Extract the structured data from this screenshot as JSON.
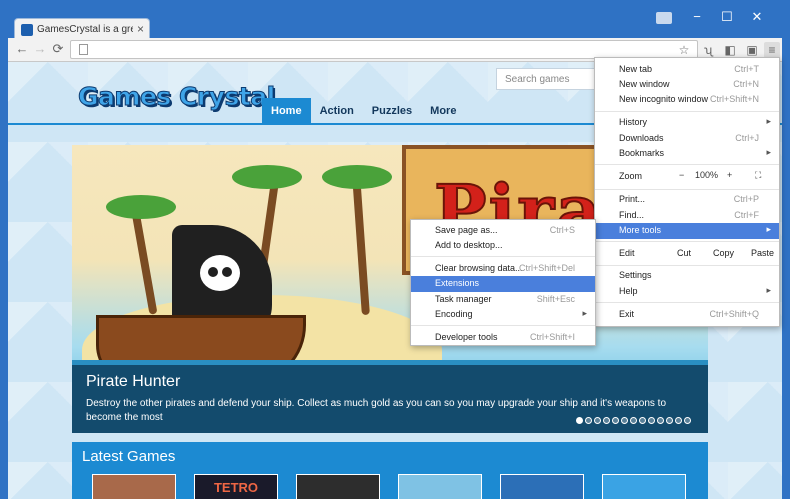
{
  "browser": {
    "tab_title": "GamesCrystal is a great pl",
    "tab_close": "×",
    "window_buttons": {
      "minimize": "−",
      "maximize": "☐",
      "close": "✕"
    }
  },
  "toolbar": {
    "back": "←",
    "forward": "→",
    "reload": "⟳",
    "star": "☆",
    "menu": "≡"
  },
  "site": {
    "logo": "Games Crystal",
    "search_placeholder": "Search games",
    "nav": [
      "Home",
      "Action",
      "Puzzles",
      "More"
    ],
    "slider": {
      "board_text": "Pirat",
      "title": "Pirate Hunter",
      "description": "Destroy the other pirates and defend your ship. Collect as much gold as you can so you may upgrade your ship and it's weapons to become the most"
    },
    "latest_title": "Latest Games",
    "latest_thumb_text": "TETRO"
  },
  "menu": {
    "new_tab": {
      "label": "New tab",
      "shortcut": "Ctrl+T"
    },
    "new_window": {
      "label": "New window",
      "shortcut": "Ctrl+N"
    },
    "incognito": {
      "label": "New incognito window",
      "shortcut": "Ctrl+Shift+N"
    },
    "history": {
      "label": "History"
    },
    "downloads": {
      "label": "Downloads",
      "shortcut": "Ctrl+J"
    },
    "bookmarks": {
      "label": "Bookmarks"
    },
    "zoom": {
      "label": "Zoom",
      "minus": "−",
      "value": "100%",
      "plus": "+"
    },
    "print": {
      "label": "Print...",
      "shortcut": "Ctrl+P"
    },
    "find": {
      "label": "Find...",
      "shortcut": "Ctrl+F"
    },
    "more_tools": {
      "label": "More tools"
    },
    "edit": {
      "label": "Edit",
      "cut": "Cut",
      "copy": "Copy",
      "paste": "Paste"
    },
    "settings": {
      "label": "Settings"
    },
    "help": {
      "label": "Help"
    },
    "exit": {
      "label": "Exit",
      "shortcut": "Ctrl+Shift+Q"
    },
    "arrow": "▸"
  },
  "submenu": {
    "save_page": {
      "label": "Save page as...",
      "shortcut": "Ctrl+S"
    },
    "add_desktop": {
      "label": "Add to desktop..."
    },
    "clear_data": {
      "label": "Clear browsing data...",
      "shortcut": "Ctrl+Shift+Del"
    },
    "extensions": {
      "label": "Extensions"
    },
    "task_manager": {
      "label": "Task manager",
      "shortcut": "Shift+Esc"
    },
    "encoding": {
      "label": "Encoding"
    },
    "dev_tools": {
      "label": "Developer tools",
      "shortcut": "Ctrl+Shift+I"
    }
  },
  "colors": {
    "accent": "#1c8ad2",
    "menu_highlight": "#4a7fdc",
    "frame": "#2f72c4"
  }
}
